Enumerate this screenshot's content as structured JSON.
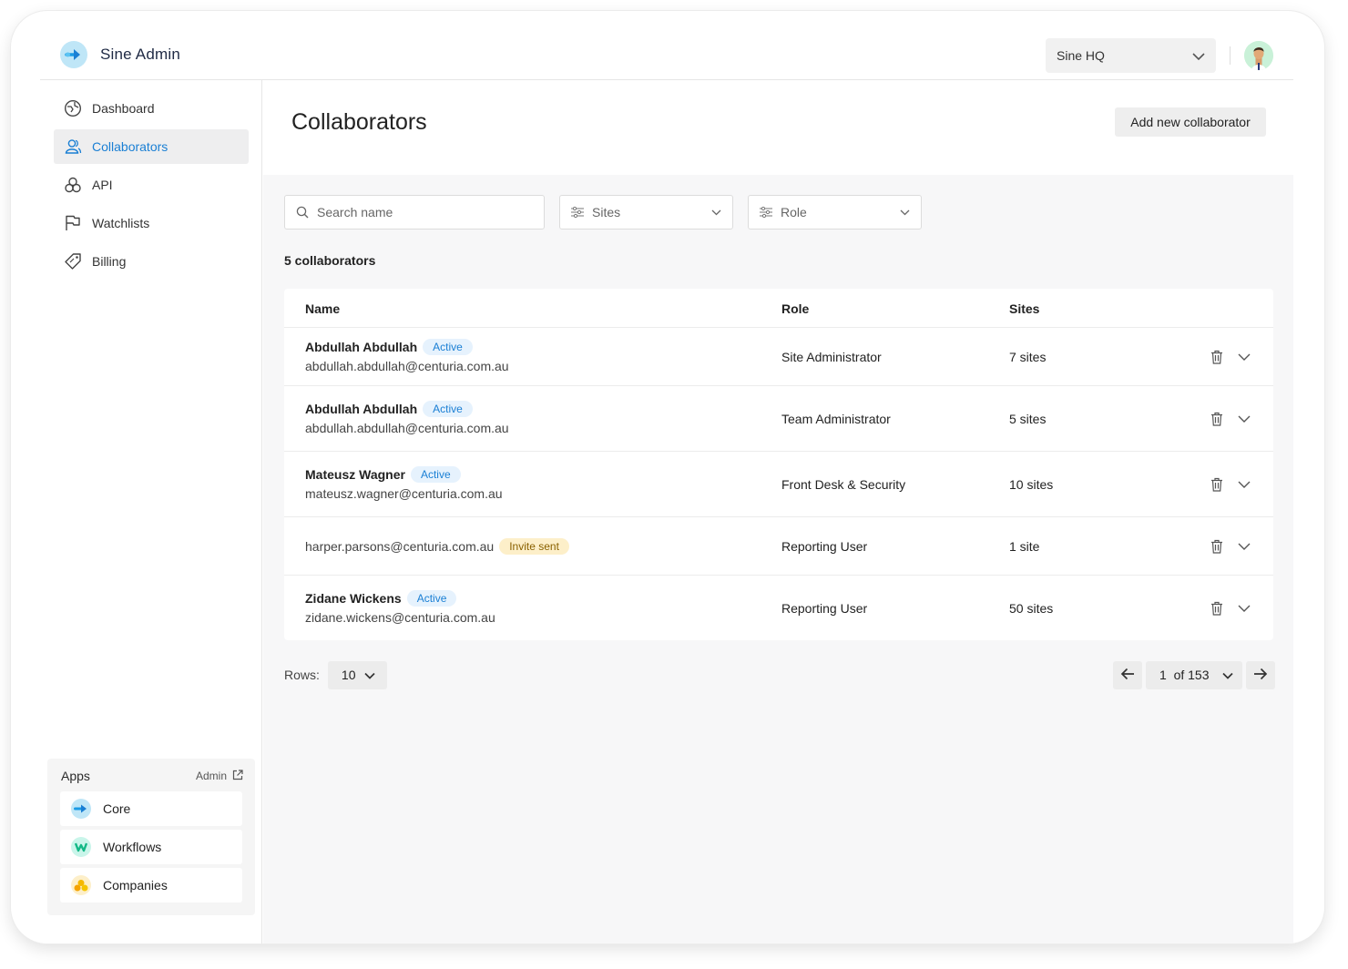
{
  "app": {
    "name": "Sine Admin"
  },
  "org_select": {
    "value": "Sine HQ"
  },
  "sidebar": {
    "items": [
      {
        "label": "Dashboard",
        "icon": "dashboard-icon",
        "active": false
      },
      {
        "label": "Collaborators",
        "icon": "users-icon",
        "active": true
      },
      {
        "label": "API",
        "icon": "api-icon",
        "active": false
      },
      {
        "label": "Watchlists",
        "icon": "flag-icon",
        "active": false
      },
      {
        "label": "Billing",
        "icon": "tag-icon",
        "active": false
      }
    ],
    "apps": {
      "title": "Apps",
      "admin_link": "Admin",
      "items": [
        {
          "label": "Core",
          "icon": "arrow-logo-icon",
          "color": "#bfe6f7"
        },
        {
          "label": "Workflows",
          "icon": "w-logo-icon",
          "color": "#c9f5ea"
        },
        {
          "label": "Companies",
          "icon": "companies-logo-icon",
          "color": "#fdefc9"
        }
      ]
    }
  },
  "page": {
    "title": "Collaborators",
    "add_button": "Add new collaborator"
  },
  "filters": {
    "search_placeholder": "Search name",
    "sites": "Sites",
    "role": "Role"
  },
  "count_text": "5 collaborators",
  "table": {
    "headers": {
      "name": "Name",
      "role": "Role",
      "sites": "Sites"
    },
    "rows": [
      {
        "name": "Abdullah Abdullah",
        "status": "Active",
        "email": "abdullah.abdullah@centuria.com.au",
        "role": "Site Administrator",
        "sites": "7 sites"
      },
      {
        "name": "Abdullah Abdullah",
        "status": "Active",
        "email": "abdullah.abdullah@centuria.com.au",
        "role": "Team Administrator",
        "sites": "5 sites"
      },
      {
        "name": "Mateusz Wagner",
        "status": "Active",
        "email": "mateusz.wagner@centuria.com.au",
        "role": "Front Desk & Security",
        "sites": "10 sites"
      },
      {
        "name": "",
        "status": "Invite sent",
        "email": "harper.parsons@centuria.com.au",
        "role": "Reporting User",
        "sites": "1 site"
      },
      {
        "name": "Zidane Wickens",
        "status": "Active",
        "email": "zidane.wickens@centuria.com.au",
        "role": "Reporting User",
        "sites": "50 sites"
      }
    ]
  },
  "pagination": {
    "rows_label": "Rows:",
    "rows_value": "10",
    "page_text": "1  of 153"
  },
  "colors": {
    "accent": "#1a7fd4",
    "active_badge_bg": "#e6f2fd",
    "invite_badge_bg": "#fdefc9"
  }
}
